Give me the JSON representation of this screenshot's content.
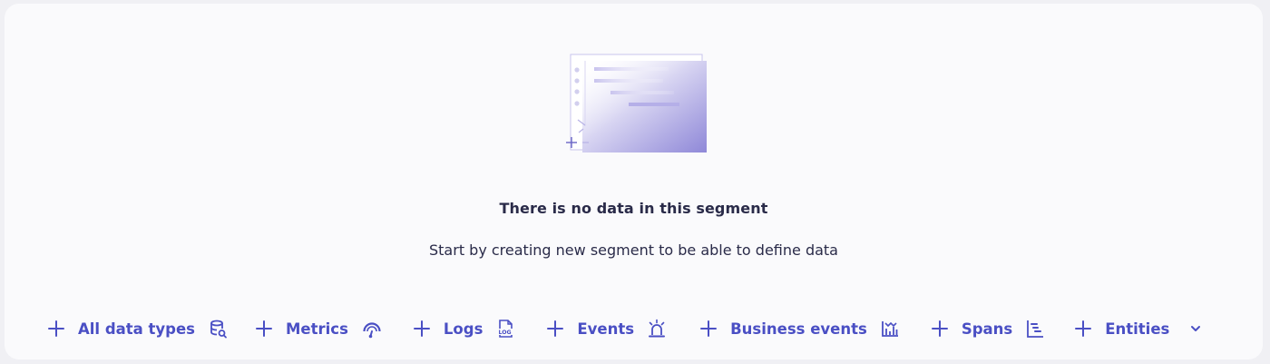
{
  "empty_state": {
    "title": "There is no data in this segment",
    "subtitle": "Start by creating new segment to be able to define data",
    "illustration_icon": "empty-segment-illustration"
  },
  "actions": [
    {
      "label": "All data types",
      "icon": "database-icon"
    },
    {
      "label": "Metrics",
      "icon": "gauge-icon"
    },
    {
      "label": "Logs",
      "icon": "log-file-icon"
    },
    {
      "label": "Events",
      "icon": "siren-icon"
    },
    {
      "label": "Business events",
      "icon": "bar-chart-icon"
    },
    {
      "label": "Spans",
      "icon": "spans-icon"
    },
    {
      "label": "Entities",
      "icon": "chevron-down-icon"
    }
  ],
  "colors": {
    "accent": "#4a4fc4",
    "text": "#2a2b49",
    "panel": "#fafafc",
    "background": "#f0f0f4",
    "illustration": "#8b86d6"
  }
}
